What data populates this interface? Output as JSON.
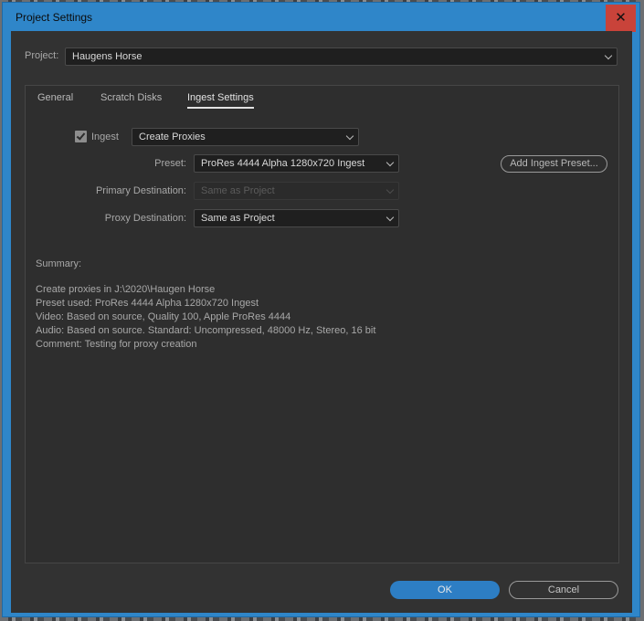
{
  "window": {
    "title": "Project Settings",
    "close_glyph": "✕"
  },
  "project": {
    "label": "Project:",
    "value": "Haugens Horse"
  },
  "tabs": [
    {
      "label": "General",
      "active": false
    },
    {
      "label": "Scratch Disks",
      "active": false
    },
    {
      "label": "Ingest Settings",
      "active": true
    }
  ],
  "ingest": {
    "checkbox_label": "Ingest",
    "checked": true,
    "mode": "Create Proxies",
    "preset_label": "Preset:",
    "preset_value": "ProRes 4444 Alpha 1280x720 Ingest",
    "add_preset_label": "Add Ingest Preset...",
    "primary_label": "Primary Destination:",
    "primary_value": "Same as Project",
    "proxy_label": "Proxy Destination:",
    "proxy_value": "Same as Project"
  },
  "summary": {
    "heading": "Summary:",
    "lines": [
      "Create proxies in J:\\2020\\Haugen Horse",
      "Preset used: ProRes 4444 Alpha 1280x720 Ingest",
      "Video: Based on source, Quality 100, Apple ProRes 4444",
      "Audio: Based on source. Standard: Uncompressed, 48000 Hz, Stereo, 16 bit",
      "Comment: Testing for proxy creation"
    ]
  },
  "buttons": {
    "ok": "OK",
    "cancel": "Cancel"
  },
  "colors": {
    "titlebar": "#2f86c9",
    "close": "#c9433a",
    "accent": "#2d7ec4",
    "dialog_bg": "#323232"
  }
}
